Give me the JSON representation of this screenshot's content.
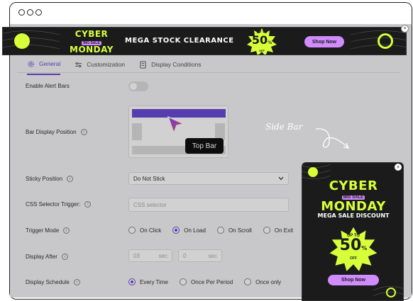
{
  "window": {
    "dots": 3
  },
  "tabs": [
    {
      "label": "General",
      "icon": "gear-icon",
      "active": true
    },
    {
      "label": "Customization",
      "icon": "sliders-icon",
      "active": false
    },
    {
      "label": "Display Conditions",
      "icon": "document-icon",
      "active": false
    }
  ],
  "settings": {
    "enable_alert_bars": {
      "label": "Enable Alert Bars",
      "value": false
    },
    "bar_display_position": {
      "label": "Bar Display Position",
      "tooltip": "Top Bar"
    },
    "sticky_position": {
      "label": "Sticky Position",
      "value": "Do Not Stick"
    },
    "css_selector_trigger": {
      "label": "CSS Selector Trigger:",
      "placeholder": "CSS selector"
    },
    "trigger_mode": {
      "label": "Trigger Mode",
      "options": [
        "On Click",
        "On Load",
        "On Scroll",
        "On Exit"
      ],
      "selected": "On Load"
    },
    "display_after": {
      "label": "Display After",
      "value1": "03",
      "unit1": "sec",
      "value2": "0",
      "unit2": "sec"
    },
    "display_schedule": {
      "label": "Display Schedule",
      "options": [
        "Every Time",
        "Once Per Period",
        "Once only"
      ],
      "selected": "Every Time"
    }
  },
  "top_banner": {
    "title_line1": "CYBER",
    "title_line2": "MONDAY",
    "badge": "BIG SALE",
    "headline": "MEGA STOCK CLEARANCE",
    "burst_top": "UP TO",
    "burst_value": "50",
    "burst_unit": "%",
    "burst_suffix": "OFF",
    "button": "Shop Now",
    "close": "×"
  },
  "side_bar_label": "Side Bar",
  "side_banner": {
    "title_line1": "CYBER",
    "badge": "BIG SALE",
    "title_line2": "MONDAY",
    "headline": "MEGA SALE DISCOUNT",
    "burst_top": "UP TO",
    "burst_value": "50",
    "burst_unit": "%",
    "burst_suffix": "OFF",
    "button": "Shop Now",
    "close": "×"
  },
  "colors": {
    "accent": "#6a4bd6",
    "banner_bg": "#1b1b1b",
    "banner_lime": "#d7ff3a",
    "banner_pink": "#d08bff"
  }
}
